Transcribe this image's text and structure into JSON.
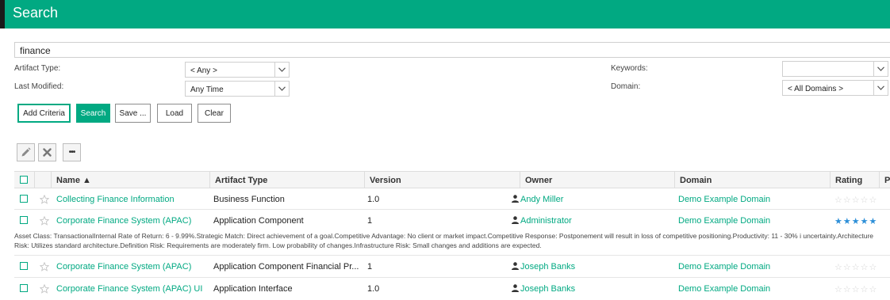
{
  "header": {
    "title": "Search"
  },
  "search": {
    "value": "finance"
  },
  "filters": {
    "artifact_type": {
      "label": "Artifact Type:",
      "value": "< Any >"
    },
    "last_modified": {
      "label": "Last Modified:",
      "value": "Any Time"
    },
    "keywords": {
      "label": "Keywords:",
      "value": ""
    },
    "domain": {
      "label": "Domain:",
      "value": "< All Domains >"
    }
  },
  "buttons": {
    "add_criteria": "Add Criteria",
    "search": "Search",
    "save": "Save ...",
    "load": "Load",
    "clear": "Clear"
  },
  "toolbar": {
    "more": "•••"
  },
  "columns": [
    "Name ▲",
    "Artifact Type",
    "Version",
    "Owner",
    "Domain",
    "Rating",
    "P"
  ],
  "rows": [
    {
      "name": "Collecting Finance Information",
      "type": "Business Function",
      "version": "1.0",
      "owner": "Andy Miller",
      "domain": "Demo Example Domain",
      "rating": 0,
      "stars": "☆☆☆☆☆"
    },
    {
      "name": "Corporate Finance System (APAC)",
      "type": "Application Component",
      "version": "1",
      "owner": "Administrator",
      "domain": "Demo Example Domain",
      "rating": 5,
      "stars": "★★★★★",
      "description": "Asset Class: TransactionalInternal Rate of Return: 6 - 9.99%.Strategic Match: Direct achievement of a goal.Competitive Advantage: No client or market impact.Competitive Response: Postponement will result in loss of competitive positioning.Productivity: 11 - 30% i uncertainty.Architecture Risk: Utilizes standard architecture.Definition Risk: Requirements are moderately firm. Low probability of changes.Infrastructure Risk: Small changes and additions are expected."
    },
    {
      "name": "Corporate Finance System (APAC)",
      "type": "Application Component Financial Pr...",
      "version": "1",
      "owner": "Joseph Banks",
      "domain": "Demo Example Domain",
      "rating": 0,
      "stars": "☆☆☆☆☆"
    },
    {
      "name": "Corporate Finance System (APAC) UI",
      "type": "Application Interface",
      "version": "1.0",
      "owner": "Joseph Banks",
      "domain": "Demo Example Domain",
      "rating": 0,
      "stars": "☆☆☆☆☆"
    }
  ],
  "colors": {
    "accent": "#01a982",
    "rating_on": "#2d8fd8"
  }
}
